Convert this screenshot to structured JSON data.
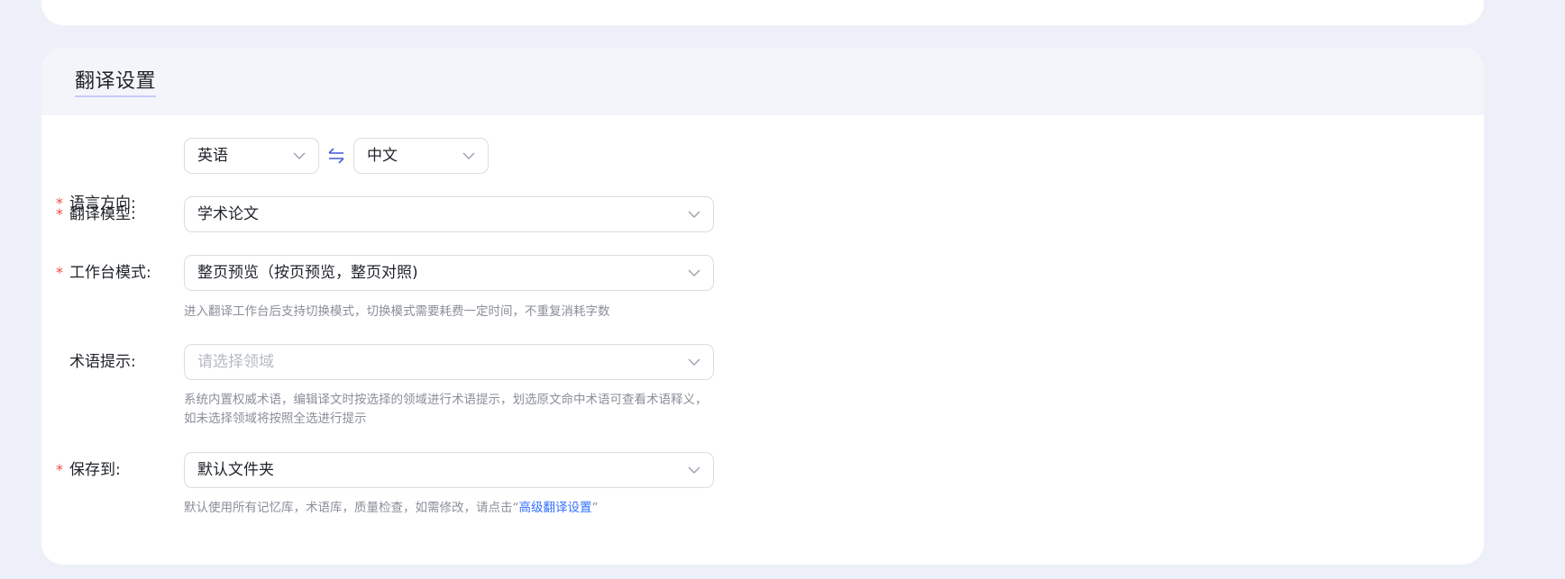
{
  "section": {
    "title": "翻译设置"
  },
  "language": {
    "label": "语言方向:",
    "source": "英语",
    "target": "中文",
    "swap_icon": "swap-arrows-icon"
  },
  "model": {
    "label": "翻译模型:",
    "value": "学术论文"
  },
  "workbench": {
    "label": "工作台模式:",
    "value": "整页预览（按页预览，整页对照)",
    "hint": "进入翻译工作台后支持切换模式，切换模式需要耗费一定时间，不重复消耗字数"
  },
  "terminology": {
    "label": "术语提示:",
    "placeholder": "请选择领域",
    "hint": "系统内置权威术语，编辑译文时按选择的领域进行术语提示，划选原文命中术语可查看术语释义，如未选择领域将按照全选进行提示"
  },
  "save": {
    "label": "保存到:",
    "value": "默认文件夹",
    "hint_prefix": "默认使用所有记忆库，术语库，质量检查，如需修改，请点击“",
    "hint_link": "高级翻译设置",
    "hint_suffix": "”"
  },
  "required_mark": "*",
  "colors": {
    "required": "#f54a45",
    "link": "#3370ff",
    "swap_icon": "#4a63d8"
  }
}
